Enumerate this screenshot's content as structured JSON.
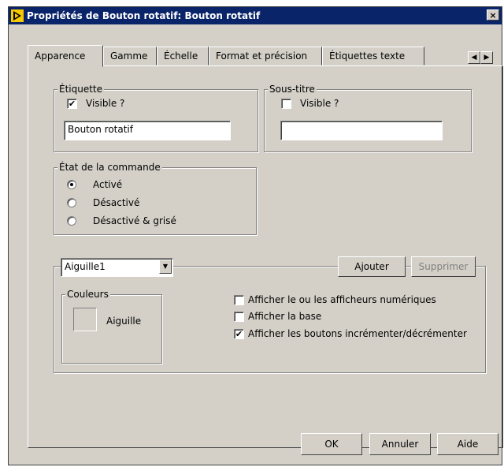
{
  "window": {
    "title": "Propriétés de Bouton rotatif: Bouton rotatif",
    "close_glyph": "×"
  },
  "tabs": [
    {
      "label": "Apparence",
      "active": true
    },
    {
      "label": "Gamme",
      "active": false
    },
    {
      "label": "Échelle",
      "active": false
    },
    {
      "label": "Format et précision",
      "active": false
    },
    {
      "label": "Étiquettes texte",
      "active": false
    }
  ],
  "tab_scroll": {
    "left": "◀",
    "right": "▶"
  },
  "etiquette": {
    "title": "Étiquette",
    "visible_label": "Visible ?",
    "visible_checked": true,
    "value": "Bouton rotatif"
  },
  "sous_titre": {
    "title": "Sous-titre",
    "visible_label": "Visible ?",
    "visible_checked": false,
    "value": ""
  },
  "etat": {
    "title": "État de la commande",
    "options": [
      {
        "label": "Activé",
        "selected": true
      },
      {
        "label": "Désactivé",
        "selected": false
      },
      {
        "label": "Désactivé & grisé",
        "selected": false
      }
    ]
  },
  "aiguille": {
    "selected": "Aiguille1",
    "add_label": "Ajouter",
    "delete_label": "Supprimer",
    "colors_title": "Couleurs",
    "color_label": "Aiguille"
  },
  "options": [
    {
      "label": "Afficher le ou les afficheurs numériques",
      "checked": false
    },
    {
      "label": "Afficher la base",
      "checked": false
    },
    {
      "label": "Afficher les boutons incrémenter/décrémenter",
      "checked": true
    }
  ],
  "footer": {
    "ok": "OK",
    "cancel": "Annuler",
    "help": "Aide"
  },
  "colors": {
    "titlebar": "#0a246a",
    "face": "#d4d0c8"
  }
}
